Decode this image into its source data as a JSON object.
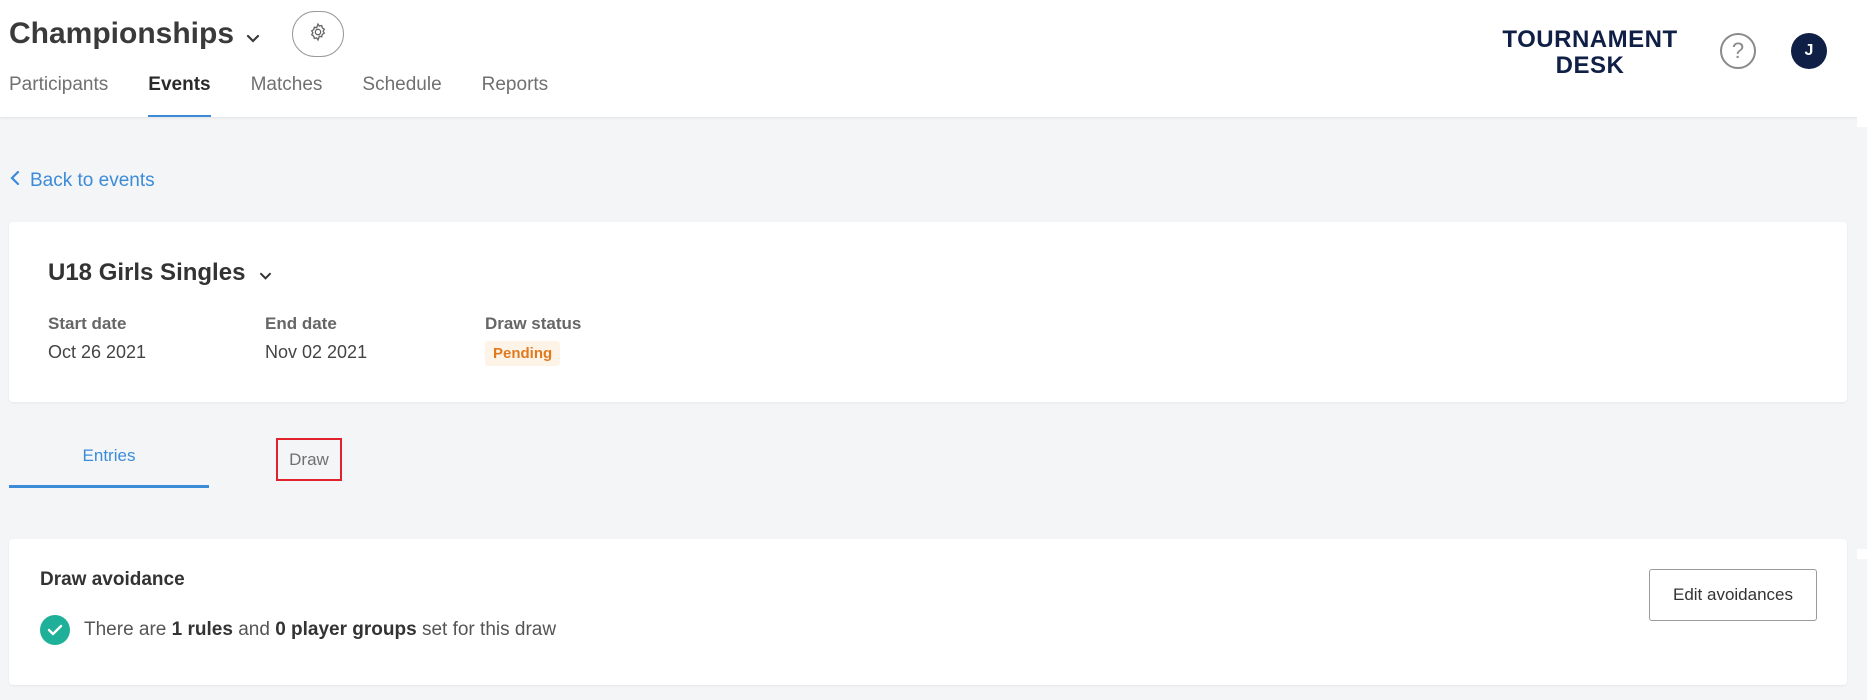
{
  "header": {
    "tournament_name": "Championships",
    "brand_line1": "TOURNAMENT",
    "brand_line2": "DESK",
    "help_label": "?",
    "avatar_initial": "J",
    "nav": [
      {
        "label": "Participants",
        "active": false
      },
      {
        "label": "Events",
        "active": true
      },
      {
        "label": "Matches",
        "active": false
      },
      {
        "label": "Schedule",
        "active": false
      },
      {
        "label": "Reports",
        "active": false
      }
    ]
  },
  "back_link": "Back to events",
  "event": {
    "title": "U18 Girls Singles",
    "start_label": "Start date",
    "start_value": "Oct 26 2021",
    "end_label": "End date",
    "end_value": "Nov 02 2021",
    "status_label": "Draw status",
    "status_value": "Pending"
  },
  "sub_tabs": {
    "entries": "Entries",
    "draw": "Draw"
  },
  "avoidance": {
    "title": "Draw avoidance",
    "text_prefix": "There are ",
    "rules_count": "1 rules",
    "text_and": " and ",
    "groups_count": "0 player groups",
    "text_suffix": " set for this draw",
    "edit_button": "Edit avoidances"
  },
  "colors": {
    "accent": "#3c8bd9",
    "brand_navy": "#0f1f45",
    "pending_text": "#e07a1f",
    "pending_bg": "#fdf3e7",
    "success": "#1fb09a",
    "highlight_border": "#e0222c"
  },
  "icons": {
    "tournament_dropdown": "chevron-down-icon",
    "settings": "gear-icon",
    "help": "help-circle-icon",
    "back": "chevron-left-icon",
    "event_dropdown": "chevron-down-icon",
    "status_ok": "check-circle-icon"
  }
}
